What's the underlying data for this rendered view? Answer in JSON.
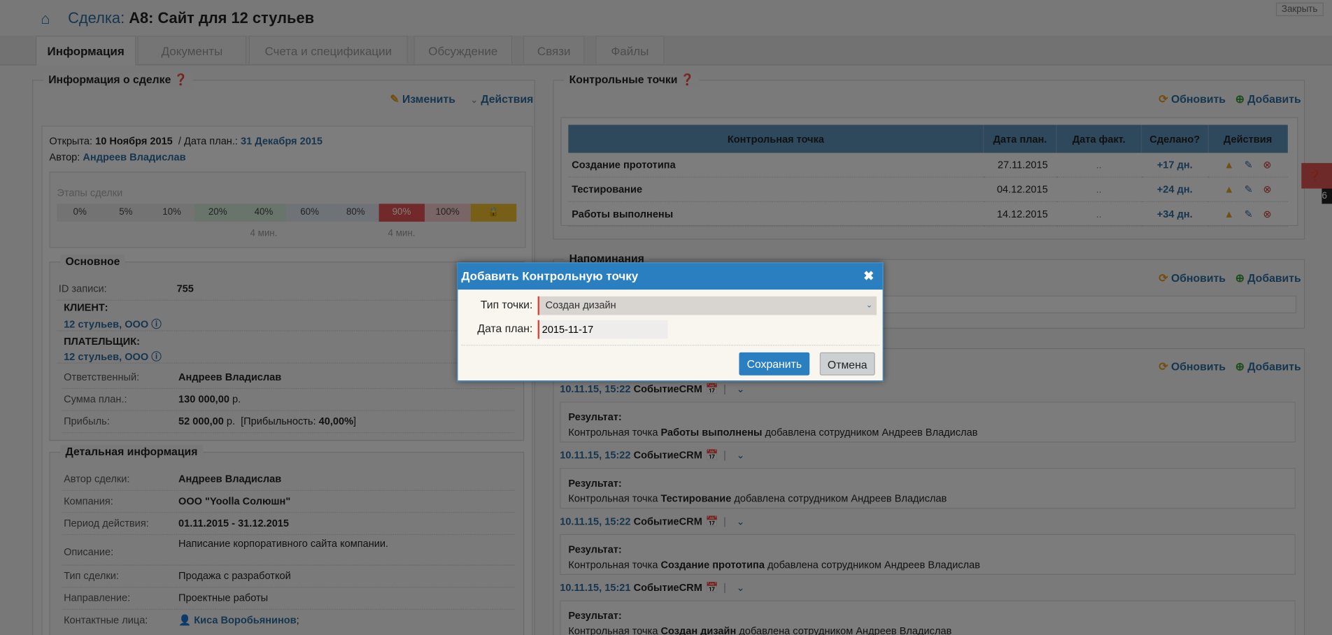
{
  "header": {
    "title_prefix": "Сделка:",
    "title": " A8: Сайт для 12 стульев",
    "close_label": "Закрыть"
  },
  "tabs": [
    {
      "label": "Информация",
      "active": true
    },
    {
      "label": "Документы"
    },
    {
      "label": "Счета и спецификации"
    },
    {
      "label": "Обсуждение"
    },
    {
      "label": "Связи"
    },
    {
      "label": "Файлы"
    }
  ],
  "deal_info": {
    "title": "Информация о сделке",
    "edit_label": "Изменить",
    "actions_label": "Действия",
    "opened_label": "Открыта:",
    "opened": "10 Ноября 2015",
    "plan_label": "/ Дата план.:",
    "plan": "31 Декабря 2015",
    "author_label": "Автор:",
    "author": "Андреев Владислав",
    "stages_title": "Этапы сделки",
    "stages": [
      {
        "label": "0%",
        "color": "#e6e6e6"
      },
      {
        "label": "5%",
        "color": "#e6e6e6"
      },
      {
        "label": "10%",
        "color": "#e6e6e6"
      },
      {
        "label": "20%",
        "color": "#cfe7d7"
      },
      {
        "label": "40%",
        "color": "#cfe7d7",
        "time": "4 мин."
      },
      {
        "label": "60%",
        "color": "#dde5ee"
      },
      {
        "label": "80%",
        "color": "#dde5ee"
      },
      {
        "label": "90%",
        "color": "#e25252",
        "time": "4 мин."
      },
      {
        "label": "100%",
        "color": "#f2c9c9"
      },
      {
        "label": "🔒",
        "color": "#f0be2e"
      }
    ]
  },
  "main": {
    "title": "Основное",
    "id_label": "ID записи:",
    "id": "755",
    "client_label": "КЛИЕНТ:",
    "client": "12 стульев, ООО",
    "payer_label": "ПЛАТЕЛЬЩИК:",
    "payer": "12 стульев, ООО",
    "rows": [
      {
        "label": "Ответственный:",
        "value": "Андреев Владислав"
      },
      {
        "label": "Сумма план.:",
        "value": "130 000,00",
        "unit": " р."
      },
      {
        "label": "Прибыль:",
        "value": "52 000,00",
        "unit": " р.  [Прибыльность: ",
        "extra": "40,00%",
        "close": "]"
      }
    ]
  },
  "detail": {
    "title": "Детальная информация",
    "rows": [
      {
        "label": "Автор сделки:",
        "value": "Андреев Владислав",
        "bold": true
      },
      {
        "label": "Компания:",
        "value": "ООО \"Yoolla Солюшн\"",
        "bold": true
      },
      {
        "label": "Период действия:",
        "value": "01.11.2015 - 31.12.2015",
        "bold": true
      },
      {
        "label": "Описание:",
        "value": "Написание корпоративного сайта компании.",
        "bold": false
      },
      {
        "label": "Тип сделки:",
        "value": "Продажа с разработкой",
        "bold": false
      },
      {
        "label": "Направление:",
        "value": "Проектные работы",
        "bold": false
      }
    ],
    "contacts_label": "Контактные лица:",
    "contact": "Киса Воробьянинов",
    "contact_sep": ";"
  },
  "checkpoints": {
    "title": "Контрольные точки",
    "refresh_label": "Обновить",
    "add_label": "Добавить",
    "columns": [
      "Контрольная точка",
      "Дата план.",
      "Дата факт.",
      "Сделано?",
      "Действия"
    ],
    "rows": [
      {
        "name": "Создание прототипа",
        "plan": "27.11.2015",
        "fact": "..",
        "done": "+17 дн."
      },
      {
        "name": "Тестирование",
        "plan": "04.12.2015",
        "fact": "..",
        "done": "+24 дн."
      },
      {
        "name": "Работы выполнены",
        "plan": "14.12.2015",
        "fact": "..",
        "done": "+34 дн."
      }
    ]
  },
  "reminders": {
    "title": "Напоминания",
    "refresh_label": "Обновить",
    "add_label": "Добавить"
  },
  "history": {
    "refresh_label": "Обновить",
    "add_label": "Добавить",
    "result_label": "Результат:",
    "prefix": "Контрольная точка ",
    "suffix": " добавлена сотрудником Андреев Владислав",
    "items": [
      {
        "time": "10.11.15, 15:22",
        "type": "СобытиеCRM",
        "point": "Работы выполнены"
      },
      {
        "time": "10.11.15, 15:22",
        "type": "СобытиеCRM",
        "point": "Тестирование"
      },
      {
        "time": "10.11.15, 15:22",
        "type": "СобытиеCRM",
        "point": "Создание прототипа"
      },
      {
        "time": "10.11.15, 15:21",
        "type": "СобытиеCRM",
        "point": "Создан дизайн"
      }
    ]
  },
  "side_widget": {
    "count": "6",
    "color": "#d9534f"
  },
  "modal": {
    "title": "Добавить Контрольную точку",
    "type_label": "Тип точки:",
    "type_value": "Создан дизайн",
    "date_label": "Дата план:",
    "date_value": "2015-11-17",
    "save_label": "Сохранить",
    "cancel_label": "Отмена"
  },
  "colors": {
    "accent": "#2a7fc0",
    "link": "#2b6c9e",
    "required": "#d34a3a"
  }
}
